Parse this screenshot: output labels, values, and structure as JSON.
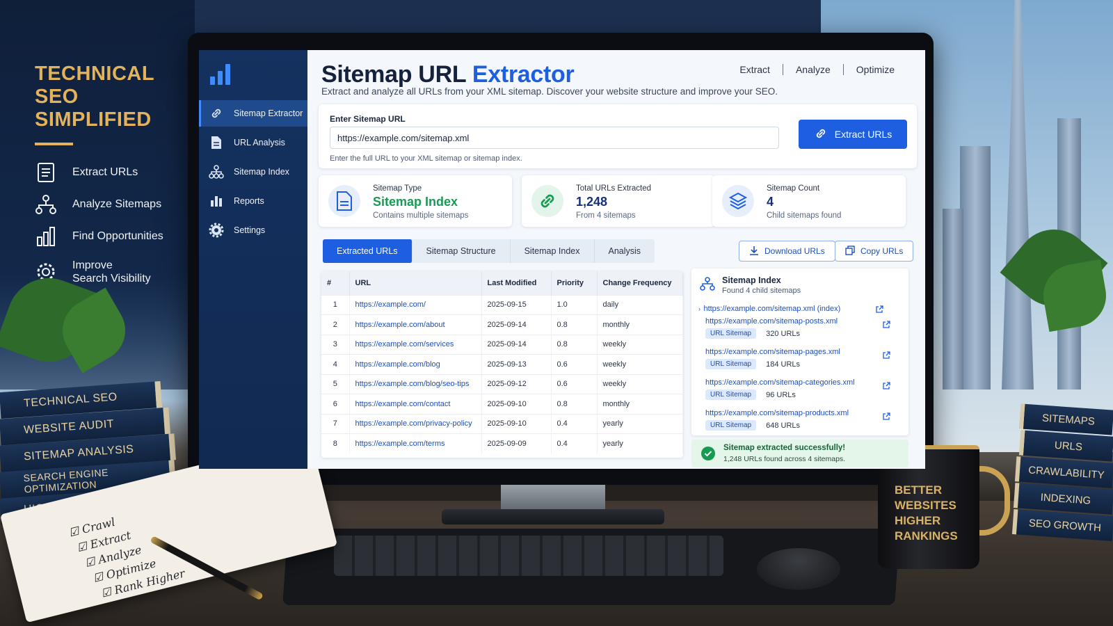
{
  "scene": {
    "side_title_lines": [
      "TECHNICAL",
      "SEO",
      "SIMPLIFIED"
    ],
    "side_items": [
      {
        "label": "Extract URLs",
        "icon": "document-list-icon"
      },
      {
        "label": "Analyze Sitemaps",
        "icon": "sitemap-tree-icon"
      },
      {
        "label": "Find Opportunities",
        "icon": "bar-chart-icon"
      },
      {
        "label": "Improve\nSearch Visibility",
        "icon": "gear-icon"
      }
    ],
    "books_left": [
      "TECHNICAL SEO",
      "WEBSITE AUDIT",
      "SITEMAP ANALYSIS",
      "SEARCH ENGINE OPTIMIZATION",
      "HIGHER RANKINGS"
    ],
    "books_right": [
      "SITEMAPS",
      "URLS",
      "CRAWLABILITY",
      "INDEXING",
      "SEO GROWTH"
    ],
    "notebook_items": [
      "Crawl",
      "Extract",
      "Analyze",
      "Optimize",
      "Rank Higher"
    ],
    "mug_text": [
      "BETTER",
      "WEBSITES",
      "HIGHER",
      "RANKINGS"
    ]
  },
  "app": {
    "sidebar": {
      "items": [
        {
          "label": "Sitemap Extractor",
          "icon": "link-icon",
          "active": true
        },
        {
          "label": "URL Analysis",
          "icon": "document-icon"
        },
        {
          "label": "Sitemap Index",
          "icon": "sitemap-tree-icon"
        },
        {
          "label": "Reports",
          "icon": "bar-chart-icon"
        },
        {
          "label": "Settings",
          "icon": "gear-icon"
        }
      ]
    },
    "title_part1": "Sitemap URL",
    "title_part2": "Extractor",
    "subtitle": "Extract and analyze all URLs from your XML sitemap. Discover your website structure and improve your SEO.",
    "topnav": [
      "Extract",
      "Analyze",
      "Optimize"
    ],
    "url_label": "Enter Sitemap URL",
    "url_value": "https://example.com/sitemap.xml",
    "url_hint": "Enter the full URL to your XML sitemap or sitemap index.",
    "extract_button": "Extract URLs",
    "stats": [
      {
        "label": "Sitemap Type",
        "value": "Sitemap Index",
        "sub": "Contains multiple sitemaps",
        "color": "#179a52"
      },
      {
        "label": "Total URLs Extracted",
        "value": "1,248",
        "sub": "From 4 sitemaps",
        "color": "#15307a"
      },
      {
        "label": "Sitemap Count",
        "value": "4",
        "sub": "Child sitemaps found",
        "color": "#15307a"
      }
    ],
    "tabs": [
      "Extracted URLs",
      "Sitemap Structure",
      "Sitemap Index",
      "Analysis"
    ],
    "download_button": "Download URLs",
    "copy_button": "Copy URLs",
    "table": {
      "headers": [
        "#",
        "URL",
        "Last Modified",
        "Priority",
        "Change Frequency"
      ],
      "rows": [
        [
          "1",
          "https://example.com/",
          "2025-09-15",
          "1.0",
          "daily"
        ],
        [
          "2",
          "https://example.com/about",
          "2025-09-14",
          "0.8",
          "monthly"
        ],
        [
          "3",
          "https://example.com/services",
          "2025-09-14",
          "0.8",
          "weekly"
        ],
        [
          "4",
          "https://example.com/blog",
          "2025-09-13",
          "0.6",
          "weekly"
        ],
        [
          "5",
          "https://example.com/blog/seo-tips",
          "2025-09-12",
          "0.6",
          "weekly"
        ],
        [
          "6",
          "https://example.com/contact",
          "2025-09-10",
          "0.8",
          "monthly"
        ],
        [
          "7",
          "https://example.com/privacy-policy",
          "2025-09-10",
          "0.4",
          "yearly"
        ],
        [
          "8",
          "https://example.com/terms",
          "2025-09-09",
          "0.4",
          "yearly"
        ]
      ]
    },
    "index": {
      "title": "Sitemap Index",
      "subtitle": "Found 4 child sitemaps",
      "root": "https://example.com/sitemap.xml (index)",
      "children": [
        {
          "url": "https://example.com/sitemap-posts.xml",
          "badge": "URL Sitemap",
          "count": "320 URLs"
        },
        {
          "url": "https://example.com/sitemap-pages.xml",
          "badge": "URL Sitemap",
          "count": "184 URLs"
        },
        {
          "url": "https://example.com/sitemap-categories.xml",
          "badge": "URL Sitemap",
          "count": "96 URLs"
        },
        {
          "url": "https://example.com/sitemap-products.xml",
          "badge": "URL Sitemap",
          "count": "648 URLs"
        }
      ]
    },
    "success_title": "Sitemap extracted successfully!",
    "success_sub": "1,248 URLs found across 4 sitemaps.",
    "colors": {
      "accent": "#1d5fe0",
      "sidebar": "#14315f",
      "gold": "#e3b25a",
      "success": "#179a52"
    }
  }
}
